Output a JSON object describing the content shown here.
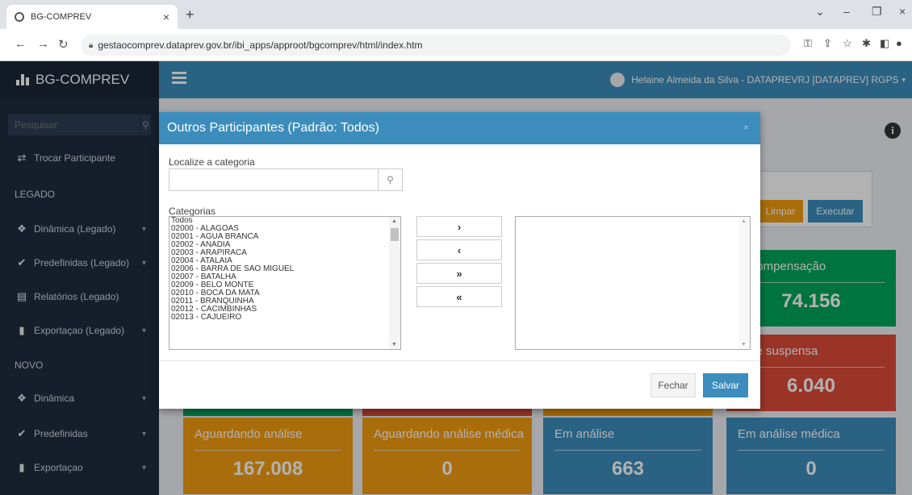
{
  "browser": {
    "tab_title": "BG-COMPREV",
    "url": "gestaocomprev.dataprev.gov.br/ibi_apps/approot/bgcomprev/html/index.htm"
  },
  "app": {
    "brand": "BG-COMPREV",
    "search_placeholder": "Pesquisar",
    "user": "Helaine Almeida da Silva - DATAPREVRJ [DATAPREV] RGPS"
  },
  "sidebar": {
    "trocar": "Trocar Participante",
    "legado_header": "LEGADO",
    "dinamica_legado": "Dinâmica (Legado)",
    "predefinidas_legado": "Predefinidas (Legado)",
    "relatorios_legado": "Relatórios (Legado)",
    "exportacao_legado": "Exportaçao (Legado)",
    "novo_header": "NOVO",
    "dinamica": "Dinâmica",
    "predefinidas": "Predefinidas",
    "exportacao": "Exportaçao"
  },
  "panel": {
    "limpar": "Limpar",
    "executar": "Executar"
  },
  "tiles": {
    "compensacao_label": "n Compensação",
    "compensacao_value": "74.156",
    "suspensa_label": "álise suspensa",
    "suspensa_value": "6.040",
    "aguardando_label": "Aguardando análise",
    "aguardando_value": "167.008",
    "aguardando_medica_label": "Aguardando análise médica",
    "aguardando_medica_value": "0",
    "em_analise_label": "Em análise",
    "em_analise_value": "663",
    "em_analise_medica_label": "Em análise médica",
    "em_analise_medica_value": "0"
  },
  "modal": {
    "title": "Outros Participantes (Padrão: Todos)",
    "close": "×",
    "localize_label": "Localize a categoria",
    "categorias_label": "Categorias",
    "options": [
      "Todos",
      "02000 - ALAGOAS",
      "02001 - AGUA BRANCA",
      "02002 - ANADIA",
      "02003 - ARAPIRACA",
      "02004 - ATALAIA",
      "02006 - BARRA DE SAO MIGUEL",
      "02007 - BATALHA",
      "02009 - BELO MONTE",
      "02010 - BOCA DA MATA",
      "02011 - BRANQUINHA",
      "02012 - CACIMBINHAS",
      "02013 - CAJUEIRO"
    ],
    "btn_move_right": "›",
    "btn_move_left": "‹",
    "btn_move_all_right": "»",
    "btn_move_all_left": "«",
    "fechar": "Fechar",
    "salvar": "Salvar"
  }
}
